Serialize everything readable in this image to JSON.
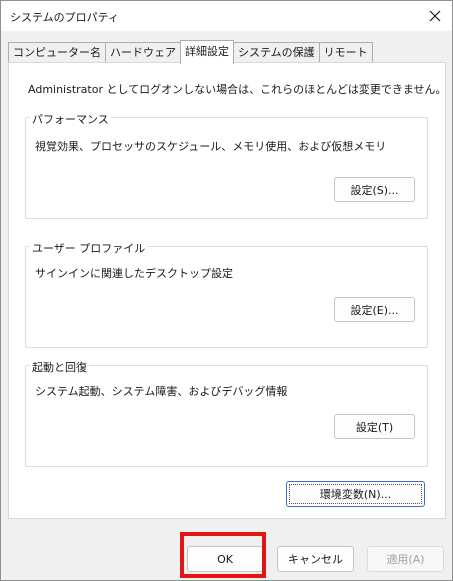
{
  "window": {
    "title": "システムのプロパティ",
    "close_icon": "close-icon"
  },
  "tabs": [
    {
      "label": "コンピューター名",
      "active": false
    },
    {
      "label": "ハードウェア",
      "active": false
    },
    {
      "label": "詳細設定",
      "active": true
    },
    {
      "label": "システムの保護",
      "active": false
    },
    {
      "label": "リモート",
      "active": false
    }
  ],
  "panel": {
    "admin_note": "Administrator としてログオンしない場合は、これらのほとんどは変更できません。",
    "performance": {
      "title": "パフォーマンス",
      "description": "視覚効果、プロセッサのスケジュール、メモリ使用、および仮想メモリ",
      "button": "設定(S)..."
    },
    "user_profiles": {
      "title": "ユーザー プロファイル",
      "description": "サインインに関連したデスクトップ設定",
      "button": "設定(E)..."
    },
    "startup_recovery": {
      "title": "起動と回復",
      "description": "システム起動、システム障害、およびデバッグ情報",
      "button": "設定(T)"
    },
    "env_button": "環境変数(N)..."
  },
  "footer": {
    "ok": "OK",
    "cancel": "キャンセル",
    "apply": "適用(A)"
  },
  "colors": {
    "highlight": "#e01616",
    "focus_border": "#3a6fc4"
  }
}
